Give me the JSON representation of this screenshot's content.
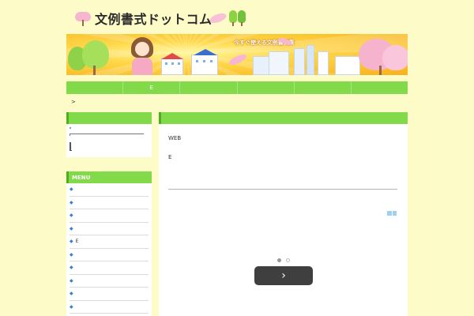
{
  "site": {
    "title": "文例書式ドットコム"
  },
  "banner": {
    "tagline": "今すぐ使える文例書式集"
  },
  "nav": {
    "items": [
      "",
      "E",
      "",
      "",
      "",
      ""
    ]
  },
  "breadcrumb": {
    "separator": ">"
  },
  "sidebar": {
    "menu_title": "MENU",
    "menu_items": [
      "",
      "",
      "",
      "",
      "E",
      "",
      "",
      "",
      "",
      ""
    ]
  },
  "main": {
    "line1": "WEB",
    "line2": "E",
    "next_label": "›"
  },
  "colors": {
    "background": "#fdfbc8",
    "accent_green": "#82d94a",
    "dark_green": "#4fae1f",
    "bullet_blue": "#3b7fd1"
  }
}
